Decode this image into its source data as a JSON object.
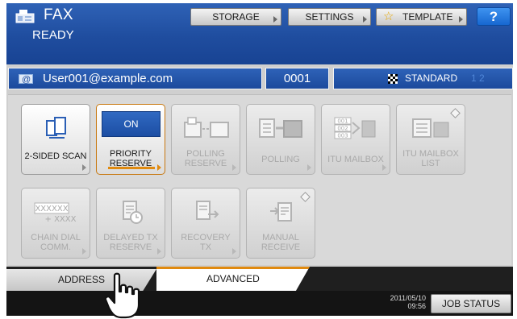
{
  "header": {
    "title": "FAX",
    "status": "READY",
    "buttons": {
      "storage": "STORAGE",
      "settings": "SETTINGS",
      "template": "TEMPLATE",
      "help": "?"
    }
  },
  "address_bar": {
    "destination": "User001@example.com",
    "count": "0001",
    "quality": "STANDARD",
    "line_indicator": "1  2"
  },
  "functions": {
    "row1": [
      {
        "id": "2-sided-scan",
        "label": "2-SIDED SCAN",
        "enabled": true,
        "icon": "duplex-scan-icon"
      },
      {
        "id": "priority-reserve",
        "badge": "ON",
        "label_line1": "PRIORITY",
        "label_line2": "RESERVE",
        "enabled": true,
        "selected": true
      },
      {
        "id": "polling-reserve",
        "label_line1": "POLLING",
        "label_line2": "RESERVE",
        "enabled": false,
        "icon": "polling-reserve-icon"
      },
      {
        "id": "polling",
        "label": "POLLING",
        "enabled": false,
        "icon": "polling-icon"
      },
      {
        "id": "itu-mailbox",
        "label": "ITU MAILBOX",
        "enabled": false,
        "icon": "itu-mailbox-icon",
        "icon_text": [
          "001",
          "002",
          "003"
        ]
      },
      {
        "id": "itu-mailbox-list",
        "label_line1": "ITU MAILBOX",
        "label_line2": "LIST",
        "enabled": false,
        "icon": "itu-mailbox-list-icon"
      }
    ],
    "row2": [
      {
        "id": "chain-dial-comm",
        "icon_text_top": "XXXXXX",
        "icon_text_bottom": "+ XXXX",
        "label_line1": "CHAIN DIAL",
        "label_line2": "COMM.",
        "enabled": false
      },
      {
        "id": "delayed-tx-reserve",
        "label_line1": "DELAYED TX",
        "label_line2": "RESERVE",
        "enabled": false,
        "icon": "delayed-tx-icon"
      },
      {
        "id": "recovery-tx",
        "label_line1": "RECOVERY",
        "label_line2": "TX",
        "enabled": false,
        "icon": "recovery-tx-icon"
      },
      {
        "id": "manual-receive",
        "label_line1": "MANUAL",
        "label_line2": "RECEIVE",
        "enabled": false,
        "icon": "manual-receive-icon"
      }
    ]
  },
  "tabs": {
    "address": "ADDRESS",
    "advanced": "ADVANCED",
    "active": "advanced"
  },
  "footer": {
    "date": "2011/05/10",
    "time": "09:56",
    "job_status": "JOB STATUS"
  },
  "colors": {
    "header_blue": "#1f4d9f",
    "accent_orange": "#e08a10",
    "help_blue": "#1667d0"
  }
}
